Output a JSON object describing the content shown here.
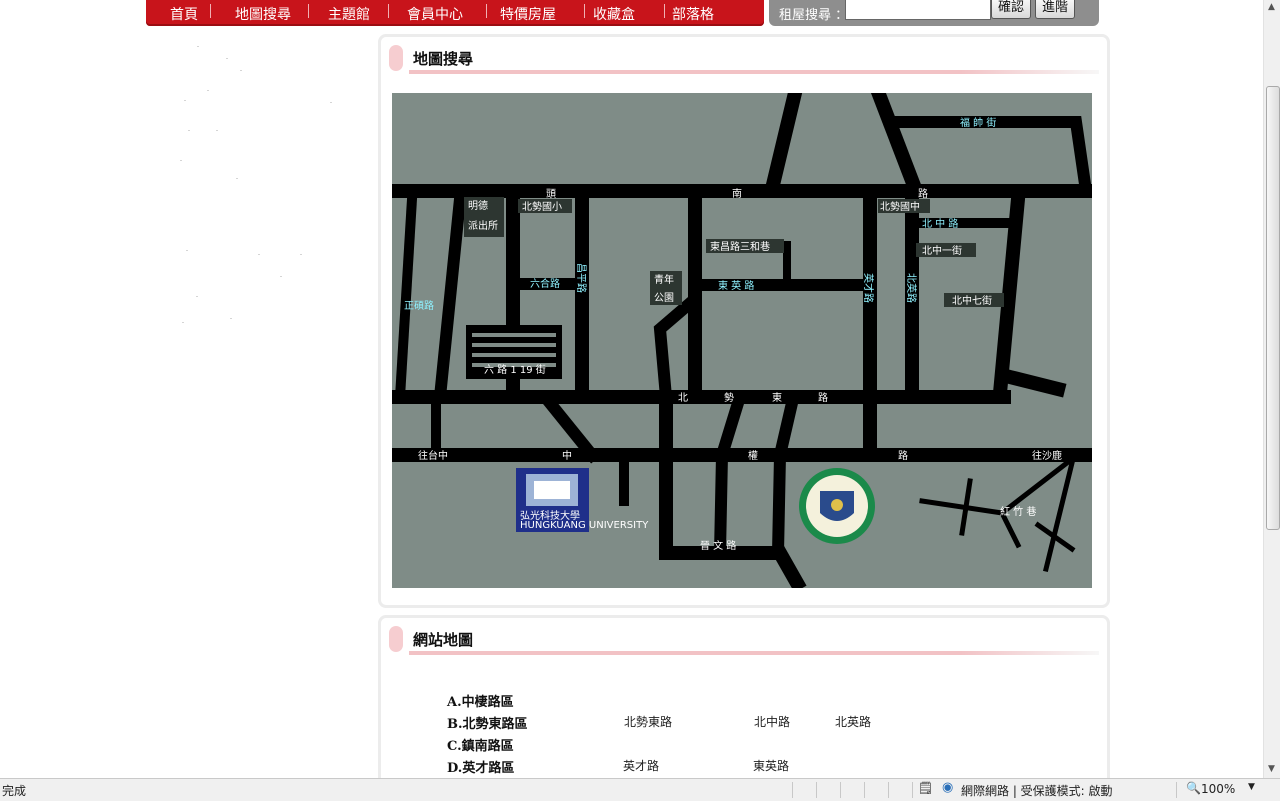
{
  "nav": {
    "items": [
      "首頁",
      "地圖搜尋",
      "主題館",
      "會員中心",
      "特價房屋",
      "收藏盒",
      "部落格"
    ]
  },
  "search": {
    "label": "租屋搜尋 ：",
    "value": "",
    "confirm_label": "確認",
    "advanced_label": "進階"
  },
  "map_panel": {
    "title": "地圖搜尋",
    "labels": {
      "road_north": [
        "頭",
        "南",
        "路"
      ],
      "road_middle": [
        "北",
        "勢",
        "東",
        "路"
      ],
      "road_south": [
        "中",
        "權",
        "路"
      ],
      "left_top": "往台中",
      "right_top": "往沙鹿",
      "fushi": "福 帥 街",
      "north_school": "北勢國小",
      "north_mid": "北勢國中",
      "police": [
        "明德",
        "派出所"
      ],
      "park": [
        "青年",
        "公園"
      ],
      "lane3": "東昌路三和巷",
      "dongying": "東 英 路",
      "beizhong": "北 中 路",
      "beizhong1": "北中一街",
      "beizhong7": "北中七街",
      "liuhe": "六合路",
      "liuhe19": "六 路 1 19 街",
      "zhengfu": "正碩路",
      "yingcai": "英才路",
      "beiying": "北英路",
      "changping": "昌平路",
      "hongzhu": "紅 竹 巷",
      "xiwen": "晉 文 路",
      "university": [
        "弘光科技大學",
        "HUNGKUANG UNIVERSITY"
      ]
    }
  },
  "sitemap": {
    "title": "網站地圖",
    "areas": [
      {
        "name": "A.中棲路區",
        "roads": []
      },
      {
        "name": "B.北勢東路區",
        "roads": [
          "北勢東路",
          "北中路",
          "北英路"
        ]
      },
      {
        "name": "C.鎮南路區",
        "roads": []
      },
      {
        "name": "D.英才路區",
        "roads": [
          "英才路",
          "東英路"
        ]
      }
    ]
  },
  "statusbar": {
    "status_text": "完成",
    "zone_text": "網際網路 | 受保護模式: 啟動",
    "zoom": "100%"
  }
}
